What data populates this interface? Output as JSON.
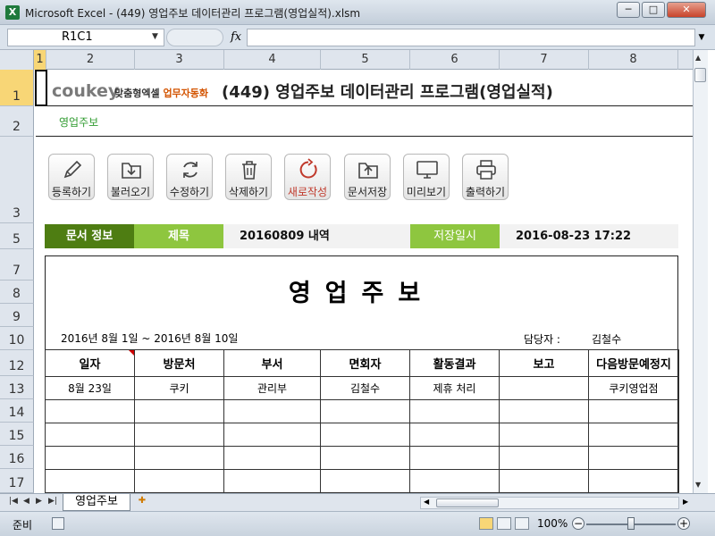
{
  "window": {
    "title": "Microsoft Excel - (449) 영업주보 데이터관리 프로그램(영업실적).xlsm",
    "app_icon": "X",
    "minimize": "─",
    "maximize": "□",
    "close": "✕"
  },
  "formula_bar": {
    "name_box": "R1C1",
    "fx": "fx",
    "value": ""
  },
  "columns": [
    "1",
    "2",
    "3",
    "4",
    "5",
    "6",
    "7",
    "8"
  ],
  "rows": [
    "1",
    "2",
    "3",
    "5",
    "7",
    "8",
    "9",
    "10",
    "12",
    "13",
    "14",
    "15",
    "16",
    "17"
  ],
  "header": {
    "logo": "coukey",
    "logo_sub_prefix": "맞춤형엑셀 ",
    "logo_sub_highlight": "업무자동화",
    "title": "(449) 영업주보 데이터관리 프로그램(영업실적)",
    "breadcrumb": "영업주보"
  },
  "toolbar": {
    "buttons": [
      {
        "label": "등록하기",
        "icon": "pencil-icon"
      },
      {
        "label": "불러오기",
        "icon": "import-icon"
      },
      {
        "label": "수정하기",
        "icon": "refresh-icon"
      },
      {
        "label": "삭제하기",
        "icon": "trash-icon"
      },
      {
        "label": "새로작성",
        "icon": "new-icon"
      },
      {
        "label": "문서저장",
        "icon": "folder-save-icon"
      },
      {
        "label": "미리보기",
        "icon": "monitor-icon"
      },
      {
        "label": "출력하기",
        "icon": "printer-icon"
      }
    ]
  },
  "doc_info": {
    "section_label": "문서 정보",
    "title_label": "제목",
    "title_value": "20160809 내역",
    "saved_label": "저장일시",
    "saved_value": "2016-08-23 17:22"
  },
  "form": {
    "title": "영업주보",
    "date_range": "2016년 8월 1일 ~ 2016년 8월 10일",
    "manager_label": "담당자 :",
    "manager_name": "김철수",
    "columns": [
      "일자",
      "방문처",
      "부서",
      "면회자",
      "활동결과",
      "보고",
      "다음방문예정지"
    ],
    "rows": [
      [
        "8월 23일",
        "쿠키",
        "관리부",
        "김철수",
        "제휴 처리",
        "",
        "쿠키영업점"
      ],
      [
        "",
        "",
        "",
        "",
        "",
        "",
        ""
      ],
      [
        "",
        "",
        "",
        "",
        "",
        "",
        ""
      ],
      [
        "",
        "",
        "",
        "",
        "",
        "",
        ""
      ],
      [
        "",
        "",
        "",
        "",
        "",
        "",
        ""
      ]
    ]
  },
  "sheet_tabs": {
    "active": "영업주보"
  },
  "status": {
    "ready": "준비",
    "zoom": "100%"
  },
  "colors": {
    "accent_dark_green": "#4e7d12",
    "accent_light_green": "#8ec63f",
    "breadcrumb_green": "#2f9b2f",
    "new_button_red": "#c0392b"
  }
}
